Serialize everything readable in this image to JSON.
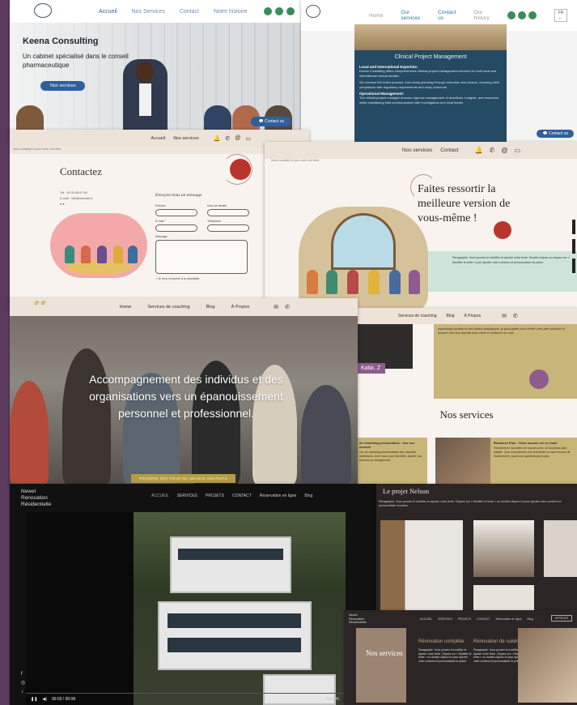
{
  "keena": {
    "nav": [
      "Accueil",
      "Nos Services",
      "Contact",
      "Notre histoire"
    ],
    "title": "Keena Consulting",
    "subtitle": "Un cabinet spécialisé dans le conseil pharmaceutique",
    "cta": "Nos services",
    "chat": "Contact us"
  },
  "clinic": {
    "nav": [
      "Home",
      "Our services",
      "Contact us",
      "Our history"
    ],
    "lang": "FR",
    "card_title": "Clinical Project Management",
    "b1": "Local and International Expertise:",
    "p1": "Keena Consulting offers comprehensive clinical project management services for both local and international clinical studies.",
    "p2": "We oversee the entire process, from study planning through execution and closure, ensuring strict compliance with regulatory requirements and study protocols.",
    "b2": "Operational Management:",
    "p3": "The clinical project manager ensures rigorous management of deadlines, budgets, and resources, while maintaining fluid communication with investigators and local teams.",
    "chat": "Contact us"
  },
  "contact": {
    "nav": [
      "Accueil",
      "Nos services"
    ],
    "strip": "Nous contacter le pour votre envi dree",
    "title": "Contactez",
    "info": [
      "Tél : 00 33 45 67 89",
      "E-mail : info@monsite.fr"
    ],
    "form_title": "Envoyez-nous un message",
    "labels": [
      "Prénom",
      "Nom de famille",
      "E-mail *",
      "Téléphone",
      "Message"
    ],
    "checkbox": "Je veux m'inscrire à la newsletter."
  },
  "faites": {
    "nav": [
      "Nos services",
      "Contact"
    ],
    "strip": "Nous contacter le pour votre envi dree",
    "title": "Faites ressortir la meilleure version de vous-même !",
    "para": "Paragraphe. Vous pouvez le modifier et ajouter votre texte. Double-cliquez ou cliquez sur « Modifier le texte » pour ajouter votre contenu et personnaliser la police."
  },
  "accomp": {
    "nav": [
      "Home",
      "Services de coaching",
      "Blog",
      "À Propos"
    ],
    "hero": "Accompagnement des individus et des organisations vers un épanouissement personnel et professionnel.",
    "cta": "PRENDRE RDV POUR MA SÉANCE GRATUITE"
  },
  "serv": {
    "nav": [
      "Services de coaching",
      "Blog",
      "À Propos"
    ],
    "katia": "Katia. Z",
    "gold_text": "psychologie positive et mes leviers stratégiques, je peux guider pour révéler votre plein potentiel et avancer vers vos objectifs avec clarté et confiance en vous.",
    "title": "Nos services",
    "card1_title": "de Coaching personnalisé : Une sur mesure",
    "card1_text": "ces de coaching personnalisés des objectifs individuels. Avec vous pour identifier, ajuster vos besoins de changement.",
    "card2_title": "Business Plan : Votre succès clé en main",
    "card2_text": "Transformez vos idées en succès avec un business plan adapté. Que vous lanciez une entreprise ou ayez besoin de financement, nous vous guidons pas à pas."
  },
  "newel": {
    "brand": [
      "Newel",
      "Renovation",
      "Résidentielle"
    ],
    "menu": [
      "ACCUEIL",
      "SERVICES",
      "PROJETS",
      "CONTACT",
      "Réservation en ligne",
      "Blog"
    ],
    "time": "00:03 / 00:08",
    "badge": "Kling AI"
  },
  "nelson": {
    "title": "Le projet Nelson",
    "desc": "Paragraphe. Vous pouvez le modifier et ajouter votre texte. Cliquez sur « Modifier le texte » ou double-cliquez ici pour ajouter votre contenu et personnaliser la police."
  },
  "newel2": {
    "brand": [
      "Newel",
      "Renovation",
      "Résidentielle"
    ],
    "menu": [
      "ACCUEIL",
      "SERVICES",
      "PROJETS",
      "CONTACT",
      "Réservation en ligne",
      "Blog"
    ],
    "btn": "APPELER",
    "services_title": "Nos services",
    "col1_title": "Rénovation complète",
    "col2_title": "Rénovation de cuisine",
    "col_text": "Paragraphe. Vous pouvez le modifier et ajouter votre texte. Cliquez sur « Modifier le texte » ou double-cliquez ici pour ajouter votre contenu et personnaliser la police."
  }
}
